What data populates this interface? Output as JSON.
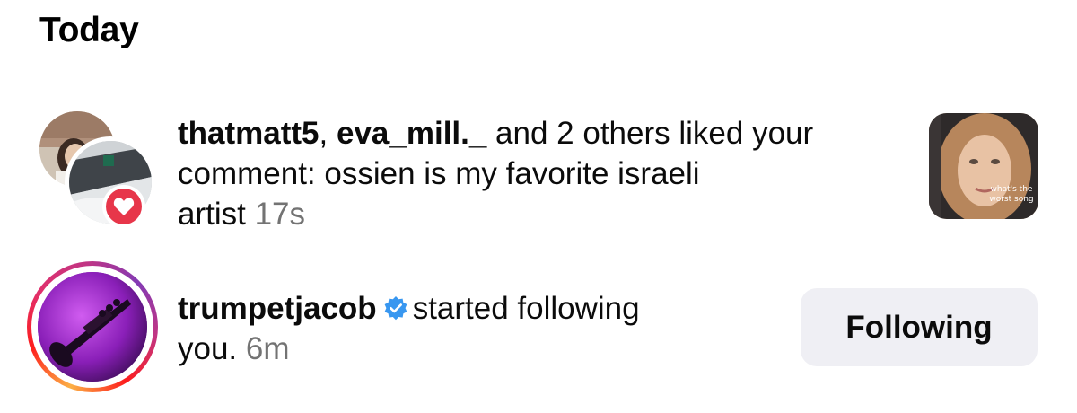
{
  "section": {
    "title": "Today"
  },
  "notifications": [
    {
      "type": "like",
      "user1": "thatmatt5",
      "separator": ", ",
      "user2": "eva_mill._",
      "message_line1_rest": " and 2 others liked your",
      "message_line2": "comment: ossien is my favorite israeli",
      "message_line3": "artist ",
      "time": "17s",
      "thumbnail_caption_line1": "what's the",
      "thumbnail_caption_line2": "worst song",
      "badge_icon": "heart-icon",
      "badge_color": "#e7364a"
    },
    {
      "type": "follow",
      "user": "trumpetjacob",
      "verified_icon": "verified-badge-icon",
      "verified_color": "#3897f0",
      "message_line1_rest": "started following",
      "message_line2": "you. ",
      "time": "6m",
      "button_label": "Following"
    }
  ],
  "colors": {
    "timestamp": "#737373",
    "button_bg": "#efeff4"
  }
}
